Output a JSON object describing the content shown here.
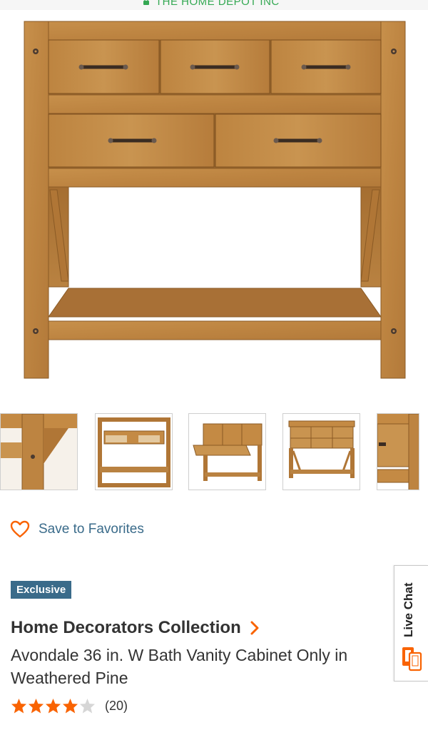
{
  "header": {
    "site_name": "THE HOME DEPOT INC"
  },
  "hero": {
    "image_icon": "vanity-cabinet-front-view"
  },
  "thumbnails": [
    {
      "icon": "vanity-leg-closeup"
    },
    {
      "icon": "vanity-top-view"
    },
    {
      "icon": "vanity-open-drawers"
    },
    {
      "icon": "vanity-angle-view"
    },
    {
      "icon": "vanity-side-closeup"
    }
  ],
  "favorites": {
    "label": "Save to Favorites",
    "icon": "heart-outline-icon"
  },
  "badge": {
    "label": "Exclusive"
  },
  "product": {
    "brand": "Home Decorators Collection",
    "title": "Avondale 36 in. W Bath Vanity Cabinet Only in Weathered Pine",
    "rating_stars": 4,
    "rating_max": 5,
    "review_count": "(20)"
  },
  "live_chat": {
    "label": "Live Chat",
    "icon": "chat-phone-icon"
  },
  "colors": {
    "accent_orange": "#f96302",
    "link_blue": "#3a6b8a",
    "secure_green": "#34a853",
    "wood": "#c48a44"
  }
}
